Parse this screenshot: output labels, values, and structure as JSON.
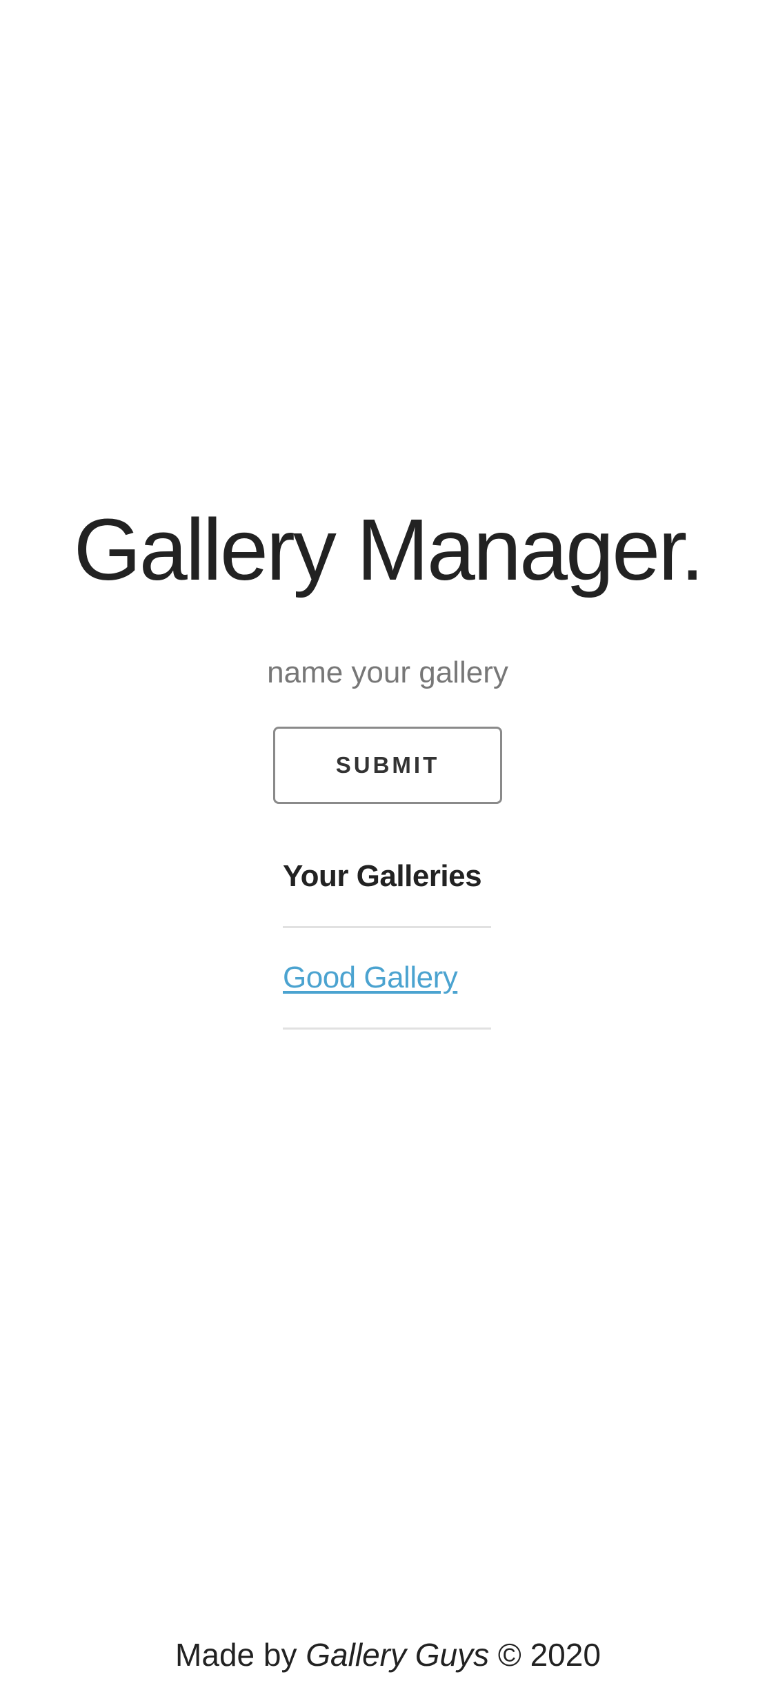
{
  "app": {
    "title": "Gallery Manager."
  },
  "form": {
    "input_placeholder": "name your gallery",
    "input_value": "",
    "submit_label": "SUBMIT"
  },
  "galleries": {
    "heading": "Your Galleries",
    "items": [
      {
        "name": "Good Gallery"
      }
    ]
  },
  "footer": {
    "prefix": "Made by",
    "brand": "Gallery Guys",
    "copyright_symbol": "©",
    "year": "2020"
  },
  "colors": {
    "text": "#222222",
    "placeholder": "#777777",
    "link": "#4ba3d0",
    "button_border": "#8a8a8a",
    "divider": "#e1e1e1"
  }
}
